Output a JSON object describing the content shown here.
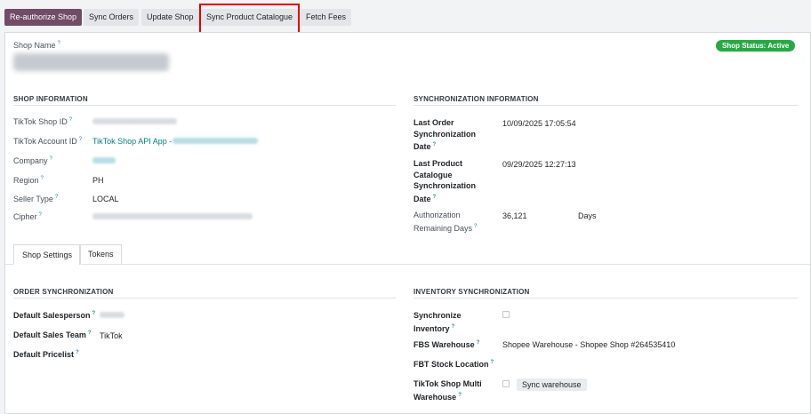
{
  "toolbar": {
    "reauthorize": "Re-authorize Shop",
    "sync_orders": "Sync Orders",
    "update_shop": "Update Shop",
    "sync_catalogue": "Sync Product Catalogue",
    "fetch_fees": "Fetch Fees"
  },
  "header": {
    "shop_name_label": "Shop Name",
    "status_badge": "Shop Status: Active"
  },
  "shop_info": {
    "title": "SHOP INFORMATION",
    "tiktok_shop_id_label": "TikTok Shop ID",
    "tiktok_account_id_label": "TikTok Account ID",
    "tiktok_account_id_value": "TikTok Shop API App -",
    "company_label": "Company",
    "region_label": "Region",
    "region_value": "PH",
    "seller_type_label": "Seller Type",
    "seller_type_value": "LOCAL",
    "cipher_label": "Cipher"
  },
  "sync_info": {
    "title": "SYNCHRONIZATION INFORMATION",
    "last_order_label": "Last Order Synchronization Date",
    "last_order_value": "10/09/2025 17:05:54",
    "last_catalogue_label": "Last Product Catalogue Synchronization Date",
    "last_catalogue_value": "09/29/2025 12:27:13",
    "auth_label": "Authorization Remaining Days",
    "auth_value": "36,121",
    "auth_unit": "Days"
  },
  "tabs": {
    "shop_settings": "Shop Settings",
    "tokens": "Tokens"
  },
  "order_sync": {
    "title": "ORDER SYNCHRONIZATION",
    "salesperson_label": "Default Salesperson",
    "sales_team_label": "Default Sales Team",
    "sales_team_value": "TikTok",
    "pricelist_label": "Default Pricelist"
  },
  "inventory_sync": {
    "title": "INVENTORY SYNCHRONIZATION",
    "sync_inventory_label": "Synchronize Inventory",
    "fbs_label": "FBS Warehouse",
    "fbs_value": "Shopee Warehouse - Shopee Shop #264535410",
    "fbt_label": "FBT Stock Location",
    "multi_label": "TikTok Shop Multi Warehouse",
    "sync_warehouse_btn": "Sync warehouse"
  },
  "help_mark": "?"
}
